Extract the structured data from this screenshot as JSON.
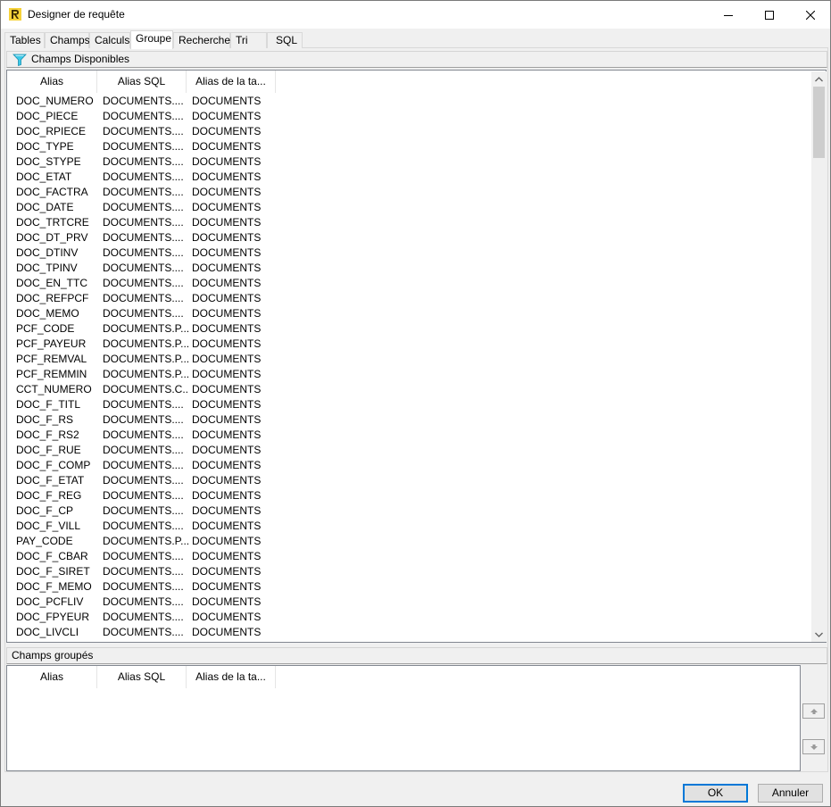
{
  "window": {
    "title": "Designer de requête"
  },
  "icons": {
    "app": "report-designer-icon",
    "minimize": "minimize-icon",
    "maximize": "maximize-icon",
    "close": "close-icon",
    "funnel": "funnel-icon",
    "scroll_up": "chevron-up-icon",
    "scroll_down": "chevron-down-icon",
    "move_up": "arrow-up-icon",
    "move_down": "arrow-down-icon"
  },
  "colors": {
    "accent": "#0078d7",
    "funnel": "#3bc9e8",
    "app_icon": "#f6d23a"
  },
  "tabs": [
    {
      "label": "Tables"
    },
    {
      "label": "Champs"
    },
    {
      "label": "Calculs"
    },
    {
      "label": "Groupe",
      "active": true
    },
    {
      "label": "Recherche"
    },
    {
      "label": "Tri"
    },
    {
      "label": "SQL"
    }
  ],
  "available_fields": {
    "header": "Champs Disponibles",
    "columns": [
      "Alias",
      "Alias SQL",
      "Alias de la ta..."
    ],
    "rows": [
      [
        "DOC_NUMERO",
        "DOCUMENTS....",
        "DOCUMENTS"
      ],
      [
        "DOC_PIECE",
        "DOCUMENTS....",
        "DOCUMENTS"
      ],
      [
        "DOC_RPIECE",
        "DOCUMENTS....",
        "DOCUMENTS"
      ],
      [
        "DOC_TYPE",
        "DOCUMENTS....",
        "DOCUMENTS"
      ],
      [
        "DOC_STYPE",
        "DOCUMENTS....",
        "DOCUMENTS"
      ],
      [
        "DOC_ETAT",
        "DOCUMENTS....",
        "DOCUMENTS"
      ],
      [
        "DOC_FACTRA",
        "DOCUMENTS....",
        "DOCUMENTS"
      ],
      [
        "DOC_DATE",
        "DOCUMENTS....",
        "DOCUMENTS"
      ],
      [
        "DOC_TRTCRE",
        "DOCUMENTS....",
        "DOCUMENTS"
      ],
      [
        "DOC_DT_PRV",
        "DOCUMENTS....",
        "DOCUMENTS"
      ],
      [
        "DOC_DTINV",
        "DOCUMENTS....",
        "DOCUMENTS"
      ],
      [
        "DOC_TPINV",
        "DOCUMENTS....",
        "DOCUMENTS"
      ],
      [
        "DOC_EN_TTC",
        "DOCUMENTS....",
        "DOCUMENTS"
      ],
      [
        "DOC_REFPCF",
        "DOCUMENTS....",
        "DOCUMENTS"
      ],
      [
        "DOC_MEMO",
        "DOCUMENTS....",
        "DOCUMENTS"
      ],
      [
        "PCF_CODE",
        "DOCUMENTS.P...",
        "DOCUMENTS"
      ],
      [
        "PCF_PAYEUR",
        "DOCUMENTS.P...",
        "DOCUMENTS"
      ],
      [
        "PCF_REMVAL",
        "DOCUMENTS.P...",
        "DOCUMENTS"
      ],
      [
        "PCF_REMMIN",
        "DOCUMENTS.P...",
        "DOCUMENTS"
      ],
      [
        "CCT_NUMERO",
        "DOCUMENTS.C...",
        "DOCUMENTS"
      ],
      [
        "DOC_F_TITL",
        "DOCUMENTS....",
        "DOCUMENTS"
      ],
      [
        "DOC_F_RS",
        "DOCUMENTS....",
        "DOCUMENTS"
      ],
      [
        "DOC_F_RS2",
        "DOCUMENTS....",
        "DOCUMENTS"
      ],
      [
        "DOC_F_RUE",
        "DOCUMENTS....",
        "DOCUMENTS"
      ],
      [
        "DOC_F_COMP",
        "DOCUMENTS....",
        "DOCUMENTS"
      ],
      [
        "DOC_F_ETAT",
        "DOCUMENTS....",
        "DOCUMENTS"
      ],
      [
        "DOC_F_REG",
        "DOCUMENTS....",
        "DOCUMENTS"
      ],
      [
        "DOC_F_CP",
        "DOCUMENTS....",
        "DOCUMENTS"
      ],
      [
        "DOC_F_VILL",
        "DOCUMENTS....",
        "DOCUMENTS"
      ],
      [
        "PAY_CODE",
        "DOCUMENTS.P...",
        "DOCUMENTS"
      ],
      [
        "DOC_F_CBAR",
        "DOCUMENTS....",
        "DOCUMENTS"
      ],
      [
        "DOC_F_SIRET",
        "DOCUMENTS....",
        "DOCUMENTS"
      ],
      [
        "DOC_F_MEMO",
        "DOCUMENTS....",
        "DOCUMENTS"
      ],
      [
        "DOC_PCFLIV",
        "DOCUMENTS....",
        "DOCUMENTS"
      ],
      [
        "DOC_FPYEUR",
        "DOCUMENTS....",
        "DOCUMENTS"
      ],
      [
        "DOC_LIVCLI",
        "DOCUMENTS....",
        "DOCUMENTS"
      ]
    ]
  },
  "grouped_fields": {
    "header": "Champs groupés",
    "columns": [
      "Alias",
      "Alias SQL",
      "Alias de la ta..."
    ],
    "rows": []
  },
  "buttons": {
    "ok": "OK",
    "cancel": "Annuler"
  }
}
